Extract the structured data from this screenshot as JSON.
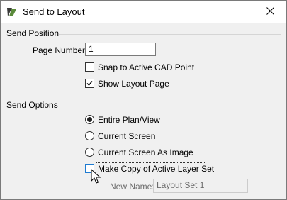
{
  "window": {
    "title": "Send to Layout"
  },
  "send_position": {
    "heading": "Send Position",
    "page_number_label": "Page Number:",
    "page_number_value": "1",
    "snap_label": "Snap to Active CAD Point",
    "snap_checked": false,
    "show_layout_label": "Show Layout Page",
    "show_layout_checked": true
  },
  "send_options": {
    "heading": "Send Options",
    "radio_entire": "Entire Plan/View",
    "radio_current": "Current Screen",
    "radio_image": "Current Screen As Image",
    "selected": "Entire Plan/View",
    "copy_layer_label": "Make Copy of Active Layer Set",
    "copy_layer_checked": false,
    "new_name_label": "New Name:",
    "new_name_value": "Layout Set 1"
  },
  "icons": {
    "app": "chief-architect-logo-icon",
    "close": "close-icon",
    "cursor": "mouse-pointer-icon"
  }
}
